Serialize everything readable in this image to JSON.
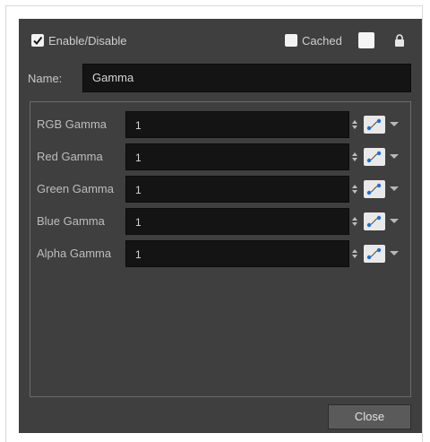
{
  "header": {
    "enable_label": "Enable/Disable",
    "enable_checked": true,
    "cached_label": "Cached",
    "cached_checked": false,
    "lock_icon": "lock-icon"
  },
  "name": {
    "label": "Name:",
    "value": "Gamma"
  },
  "parameters": [
    {
      "label": "RGB Gamma",
      "value": "1"
    },
    {
      "label": "Red Gamma",
      "value": "1"
    },
    {
      "label": "Green Gamma",
      "value": "1"
    },
    {
      "label": "Blue Gamma",
      "value": "1"
    },
    {
      "label": "Alpha Gamma",
      "value": "1"
    }
  ],
  "footer": {
    "close_label": "Close"
  },
  "colors": {
    "panel": "#3f3f3f",
    "field": "#141414",
    "accent": "#1f6fd1"
  }
}
